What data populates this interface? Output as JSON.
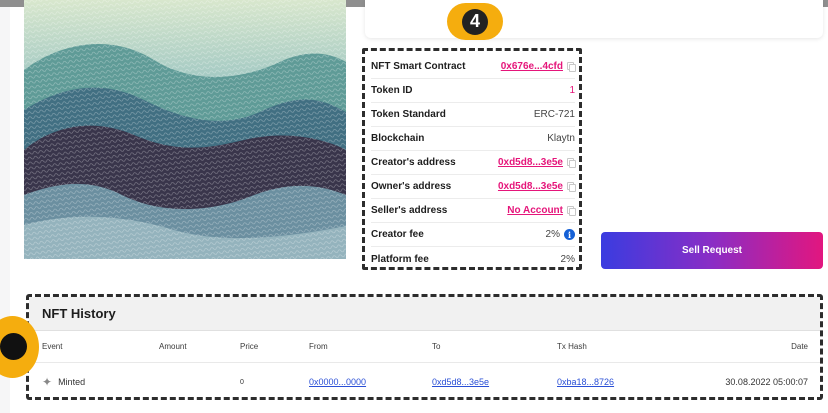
{
  "info": {
    "rows": [
      {
        "label": "NFT Smart Contract",
        "value": "0x676e...4cfd"
      },
      {
        "label": "Token ID",
        "value": "1"
      },
      {
        "label": "Token Standard",
        "value": "ERC-721"
      },
      {
        "label": "Blockchain",
        "value": "Klaytn"
      },
      {
        "label": "Creator's address",
        "value": "0xd5d8...3e5e"
      },
      {
        "label": "Owner's address",
        "value": "0xd5d8...3e5e"
      },
      {
        "label": "Seller's address",
        "value": "No Account"
      },
      {
        "label": "Creator fee",
        "value": "2%"
      },
      {
        "label": "Platform fee",
        "value": "2%"
      }
    ]
  },
  "badges": {
    "step4": "4"
  },
  "sell_button_label": "Sell Request",
  "history": {
    "title": "NFT History",
    "columns": [
      "Event",
      "Amount",
      "Price",
      "From",
      "To",
      "Tx Hash",
      "Date"
    ],
    "rows": [
      {
        "event": "Minted",
        "amount": "",
        "price": "0",
        "from": "0x0000...0000",
        "to": "0xd5d8...3e5e",
        "tx_hash": "0xba18...8726",
        "date": "30.08.2022 05:00:07"
      }
    ]
  },
  "icons": {
    "copy": "copy-icon",
    "info": "info-icon",
    "minted": "sparkle-icon"
  },
  "colors": {
    "accent_pink": "#e5157a",
    "link_blue": "#2a4fd6",
    "badge_orange": "#f5ad0e"
  }
}
